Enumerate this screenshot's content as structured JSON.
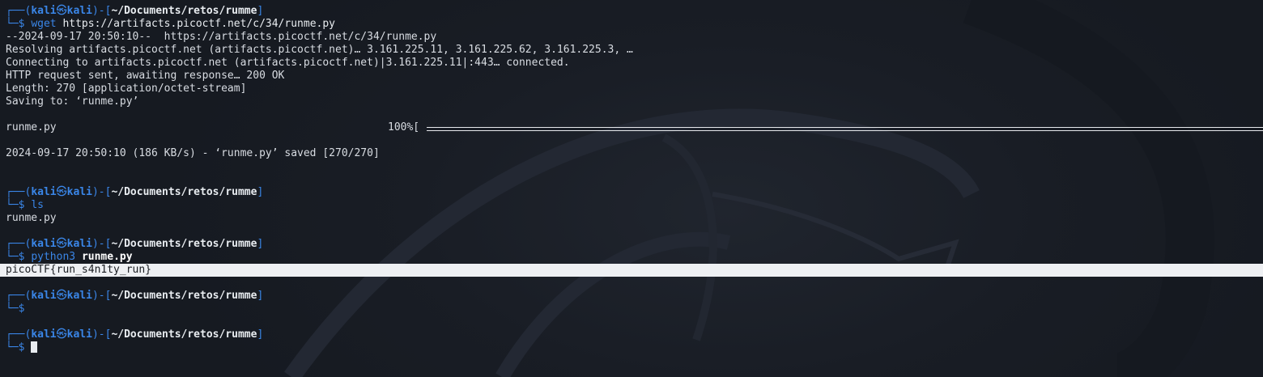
{
  "prompt": {
    "user": "kali",
    "host": "kali",
    "skull": "㉿",
    "path": "~/Documents/retos/rumme",
    "top_open": "┌──(",
    "top_close": ")-[",
    "bracket_close": "]",
    "bottom": "└─$"
  },
  "session": [
    {
      "command": "wget",
      "args": "https://artifacts.picoctf.net/c/34/runme.py"
    },
    {
      "command": "ls",
      "args": ""
    },
    {
      "command": "python3",
      "args": "runme.py"
    }
  ],
  "wget_output": {
    "line1": "--2024-09-17 20:50:10--  https://artifacts.picoctf.net/c/34/runme.py",
    "line2": "Resolving artifacts.picoctf.net (artifacts.picoctf.net)… 3.161.225.11, 3.161.225.62, 3.161.225.3, …",
    "line3": "Connecting to artifacts.picoctf.net (artifacts.picoctf.net)|3.161.225.11|:443… connected.",
    "line4": "HTTP request sent, awaiting response… 200 OK",
    "line5": "Length: 270 [application/octet-stream]",
    "line6": "Saving to: ‘runme.py’",
    "progress_file": "runme.py",
    "progress_percent": "100%[",
    "progress_value": 1.0,
    "summary": "2024-09-17 20:50:10 (186 KB/s) - ‘runme.py’ saved [270/270]"
  },
  "ls_output": "runme.py",
  "python_output": "picoCTF{run_s4n1ty_run}",
  "colors": {
    "accent": "#3a86e8",
    "background": "#191d25",
    "highlight": "#eef0f3"
  }
}
